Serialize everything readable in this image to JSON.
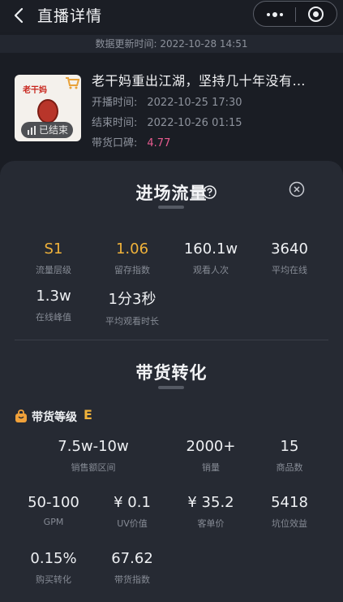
{
  "nav": {
    "title": "直播详情"
  },
  "update": {
    "label": "数据更新时间: 2022-10-28 14:51"
  },
  "product": {
    "title": "老干妈重出江湖，坚持几十年没有…",
    "status_badge": "已结束",
    "thumb_text": "老干妈",
    "start_label": "开播时间:",
    "start_value": "2022-10-25 17:30",
    "end_label": "结束时间:",
    "end_value": "2022-10-26 01:15",
    "rating_label": "带货口碑:",
    "rating_value": "4.77"
  },
  "traffic": {
    "title": "进场流量",
    "stats": [
      {
        "value": "S1",
        "label": "流量层级"
      },
      {
        "value": "1.06",
        "label": "留存指数"
      },
      {
        "value": "160.1w",
        "label": "观看人次"
      },
      {
        "value": "3640",
        "label": "平均在线"
      },
      {
        "value": "1.3w",
        "label": "在线峰值"
      },
      {
        "value": "1分3秒",
        "label": "平均观看时长"
      }
    ]
  },
  "conversion": {
    "title": "带货转化",
    "grade_label": "带货等级",
    "grade_value": "E",
    "stats": [
      {
        "value": "7.5w-10w",
        "label": "销售额区间"
      },
      {
        "value": "2000+",
        "label": "销量"
      },
      {
        "value": "15",
        "label": "商品数"
      },
      {
        "value": "50-100",
        "label": "GPM"
      },
      {
        "value": "¥ 0.1",
        "label": "UV价值"
      },
      {
        "value": "¥ 35.2",
        "label": "客单价"
      },
      {
        "value": "5418",
        "label": "坑位效益"
      },
      {
        "value": "0.15%",
        "label": "购买转化"
      },
      {
        "value": "67.62",
        "label": "带货指数"
      }
    ]
  },
  "colors": {
    "accent_gold": "#f0b23a",
    "rating_pink": "#e75b8f",
    "sheet_bg": "#262a33"
  }
}
